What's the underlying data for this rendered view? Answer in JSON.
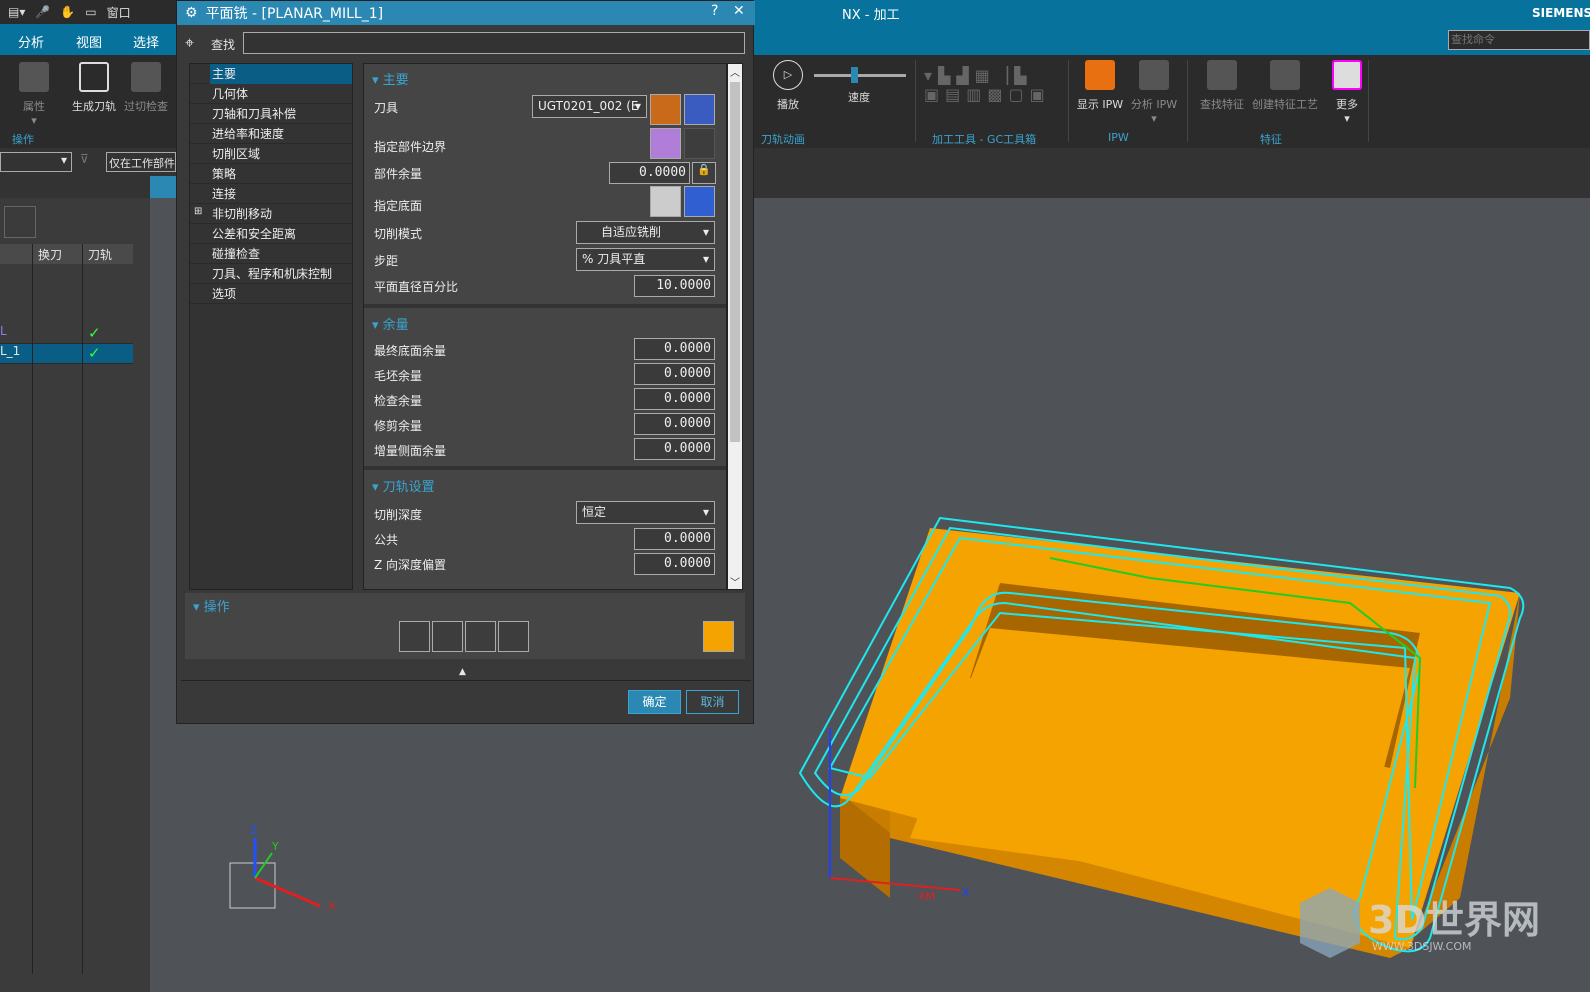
{
  "app": {
    "title": "NX - 加工",
    "brand": "SIEMENS",
    "search_placeholder": "查找命令",
    "window_menu": "窗口"
  },
  "tabs": [
    "分析",
    "视图",
    "选择"
  ],
  "ribbon": {
    "left": [
      {
        "label": "属性"
      },
      {
        "label": "生成刀轨"
      },
      {
        "label": "过切检查"
      }
    ],
    "group_ops": "操作",
    "play": "播放",
    "speed": "速度",
    "group_anim": "刀轨动画",
    "group_gc": "加工工具 - GC工具箱",
    "show_ipw": "显示 IPW",
    "analyze_ipw": "分析 IPW",
    "group_ipw": "IPW",
    "find_feature": "查找特征",
    "create_feature_process": "创建特征工艺",
    "more": "更多",
    "group_feature": "特征"
  },
  "filter": {
    "scope": "仅在工作部件中"
  },
  "navigator": {
    "columns": [
      "换刀",
      "刀轨"
    ],
    "rows": [
      {
        "name": "L",
        "check": true
      },
      {
        "name": "L_1",
        "check": true,
        "selected": true
      }
    ]
  },
  "dialog": {
    "title": "平面铣 - [PLANAR_MILL_1]",
    "help": "?",
    "close": "✕",
    "find_label": "查找",
    "find_value": "",
    "tree": [
      "主要",
      "几何体",
      "刀轴和刀具补偿",
      "进给率和速度",
      "切削区域",
      "策略",
      "连接",
      "非切削移动",
      "公差和安全距离",
      "碰撞检查",
      "刀具、程序和机床控制",
      "选项"
    ],
    "main": {
      "title": "主要",
      "tool_label": "刀具",
      "tool_value": "UGT0201_002 (E",
      "part_boundary": "指定部件边界",
      "part_stock_label": "部件余量",
      "part_stock": "0.0000",
      "floor": "指定底面",
      "cut_pattern_label": "切削模式",
      "cut_pattern": "自适应铣削",
      "stepover_label": "步距",
      "stepover": "% 刀具平直",
      "percent_label": "平面直径百分比",
      "percent": "10.0000"
    },
    "stock": {
      "title": "余量",
      "rows": [
        {
          "label": "最终底面余量",
          "value": "0.0000"
        },
        {
          "label": "毛坯余量",
          "value": "0.0000"
        },
        {
          "label": "检查余量",
          "value": "0.0000"
        },
        {
          "label": "修剪余量",
          "value": "0.0000"
        },
        {
          "label": "增量侧面余量",
          "value": "0.0000"
        }
      ]
    },
    "path": {
      "title": "刀轨设置",
      "depth_label": "切削深度",
      "depth": "恒定",
      "common_label": "公共",
      "common": "0.0000",
      "zoff_label": "Z 向深度偏置",
      "zoff": "0.0000"
    },
    "ops": {
      "title": "操作"
    },
    "ok": "确定",
    "cancel": "取消"
  },
  "viewport": {
    "axes": {
      "x": "X",
      "y": "Y",
      "z": "Z",
      "xm": "XM"
    },
    "watermark": "3D世界网",
    "watermark_url": "WWW.3DSJW.COM"
  },
  "colors": {
    "accent": "#07739c",
    "part": "#f5a300",
    "toolpath": "#1de8f0"
  }
}
